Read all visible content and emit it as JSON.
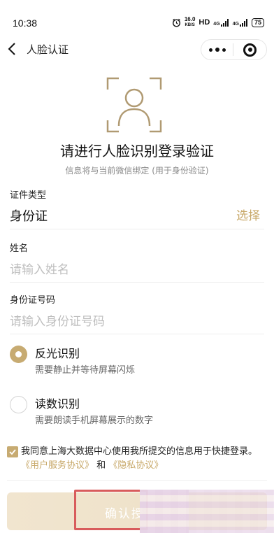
{
  "status_bar": {
    "time": "10:38",
    "speed_top": "16.0",
    "speed_bottom": "KB/S",
    "hd": "HD",
    "signal1": "4G",
    "signal2": "4G",
    "battery": "75"
  },
  "nav": {
    "title": "人脸认证",
    "back_icon": "chevron-left-icon",
    "more_icon": "more-dots-icon",
    "close_icon": "miniprogram-close-icon"
  },
  "header": {
    "icon": "face-frame-icon",
    "title": "请进行人脸识别登录验证",
    "subtitle": "信息将与当前微信绑定 (用于身份验证)"
  },
  "form": {
    "id_type": {
      "label": "证件类型",
      "value": "身份证",
      "action": "选择"
    },
    "name": {
      "label": "姓名",
      "placeholder": "请输入姓名"
    },
    "id_number": {
      "label": "身份证号码",
      "placeholder": "请输入身份证号码"
    }
  },
  "methods": [
    {
      "title": "反光识别",
      "desc": "需要静止并等待屏幕闪烁",
      "selected": true
    },
    {
      "title": "读数识别",
      "desc": "需要朗读手机屏幕展示的数字",
      "selected": false
    }
  ],
  "agreement": {
    "checked": true,
    "text_part1": "我同意上海大数据中心使用我所提交的信息用于快捷登录。",
    "link1": "《用户服务协议》",
    "and": "和",
    "link2": "《隐私协议》"
  },
  "confirm": {
    "label": "确认授"
  },
  "colors": {
    "accent": "#c7ab72",
    "button_bg": "#f1e5cf",
    "highlight_border": "#d85c5c"
  }
}
